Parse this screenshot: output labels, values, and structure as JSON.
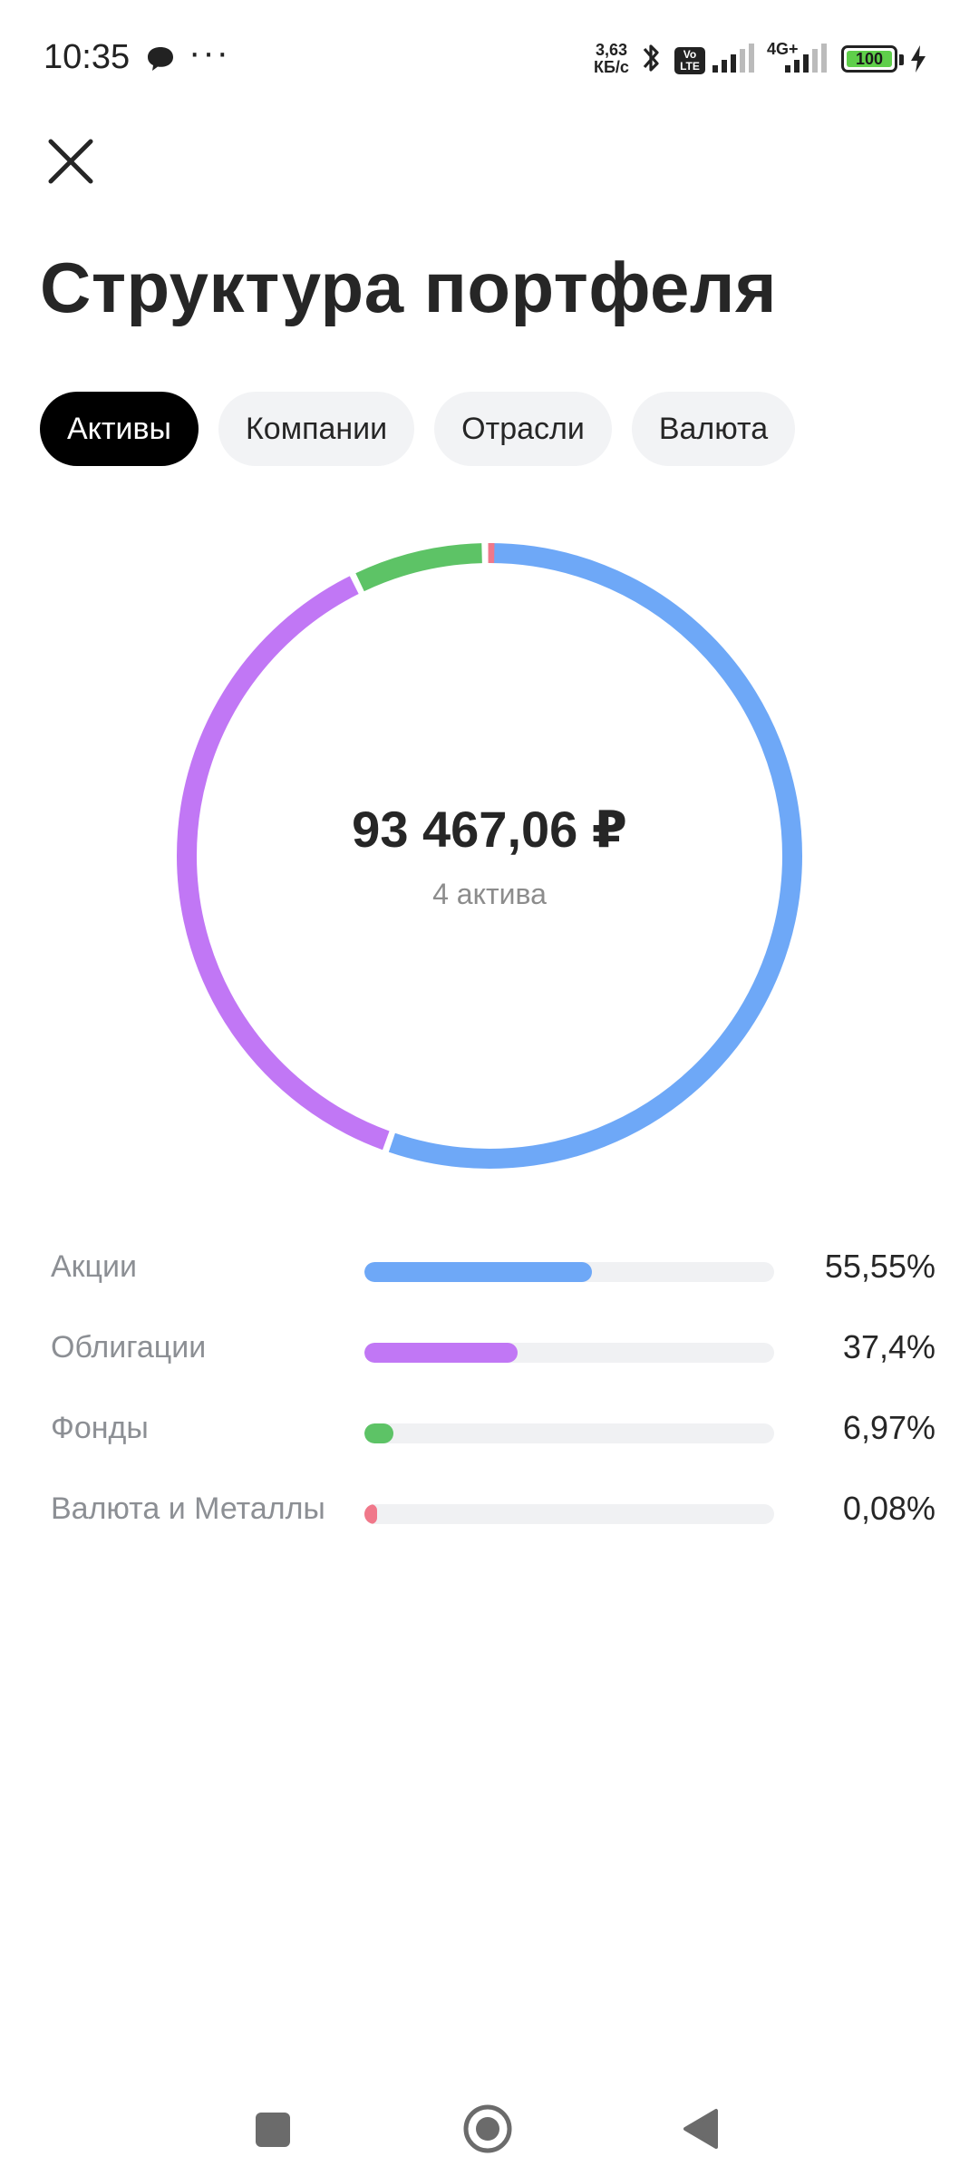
{
  "status_bar": {
    "time": "10:35",
    "net_speed_value": "3,63",
    "net_speed_unit": "КБ/с",
    "volte": "Vo LTE",
    "network": "4G+",
    "battery": "100",
    "icons": [
      "chat-bubble-icon",
      "more-dots-icon",
      "bluetooth-icon",
      "signal-icon",
      "battery-icon",
      "charging-icon"
    ]
  },
  "header": {
    "close_icon": "close-icon",
    "title": "Структура портфеля"
  },
  "tabs": [
    {
      "label": "Активы",
      "active": true
    },
    {
      "label": "Компании",
      "active": false
    },
    {
      "label": "Отрасли",
      "active": false
    },
    {
      "label": "Валюта",
      "active": false
    }
  ],
  "summary": {
    "total": "93 467,06 ₽",
    "count": "4 актива"
  },
  "breakdown": [
    {
      "label": "Акции",
      "percent_text": "55,55%",
      "value": 55.55,
      "color": "#6ea8f7"
    },
    {
      "label": "Облигации",
      "percent_text": "37,4%",
      "value": 37.4,
      "color": "#c177f5"
    },
    {
      "label": "Фонды",
      "percent_text": "6,97%",
      "value": 6.97,
      "color": "#5dc366"
    },
    {
      "label": "Валюта и Металлы",
      "percent_text": "0,08%",
      "value": 0.08,
      "color": "#f0788a"
    }
  ],
  "nav": {
    "icons": [
      "recent-apps-icon",
      "home-icon",
      "back-icon"
    ]
  }
}
